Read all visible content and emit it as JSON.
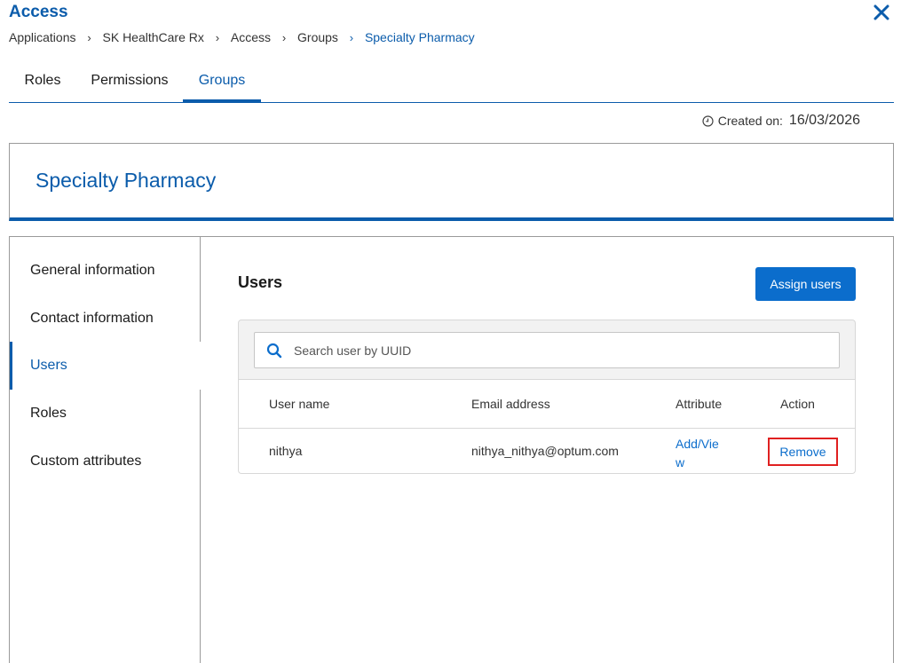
{
  "page": {
    "title": "Access",
    "close_icon": "close-icon"
  },
  "breadcrumb": [
    "Applications",
    "SK HealthCare Rx",
    "Access",
    "Groups",
    "Specialty Pharmacy"
  ],
  "tabs": [
    {
      "label": "Roles",
      "active": false
    },
    {
      "label": "Permissions",
      "active": false
    },
    {
      "label": "Groups",
      "active": true
    }
  ],
  "created": {
    "label": "Created on:",
    "date": "16/03/2026",
    "icon": "clock-icon"
  },
  "group": {
    "name": "Specialty Pharmacy"
  },
  "sidenav": [
    {
      "label": "General information",
      "active": false
    },
    {
      "label": "Contact information",
      "active": false
    },
    {
      "label": "Users",
      "active": true
    },
    {
      "label": "Roles",
      "active": false
    },
    {
      "label": "Custom attributes",
      "active": false
    }
  ],
  "users": {
    "title": "Users",
    "assign_label": "Assign users",
    "search_placeholder": "Search user by UUID",
    "columns": [
      "User name",
      "Email address",
      "Attribute",
      "Action"
    ],
    "rows": [
      {
        "user_name": "nithya",
        "email": "nithya_nithya@optum.com",
        "attribute_line1": "Add/Vie",
        "attribute_line2": "w",
        "action": "Remove"
      }
    ]
  },
  "colors": {
    "accent": "#0b5cab",
    "button": "#0b6dcc",
    "highlight": "#e02020"
  }
}
